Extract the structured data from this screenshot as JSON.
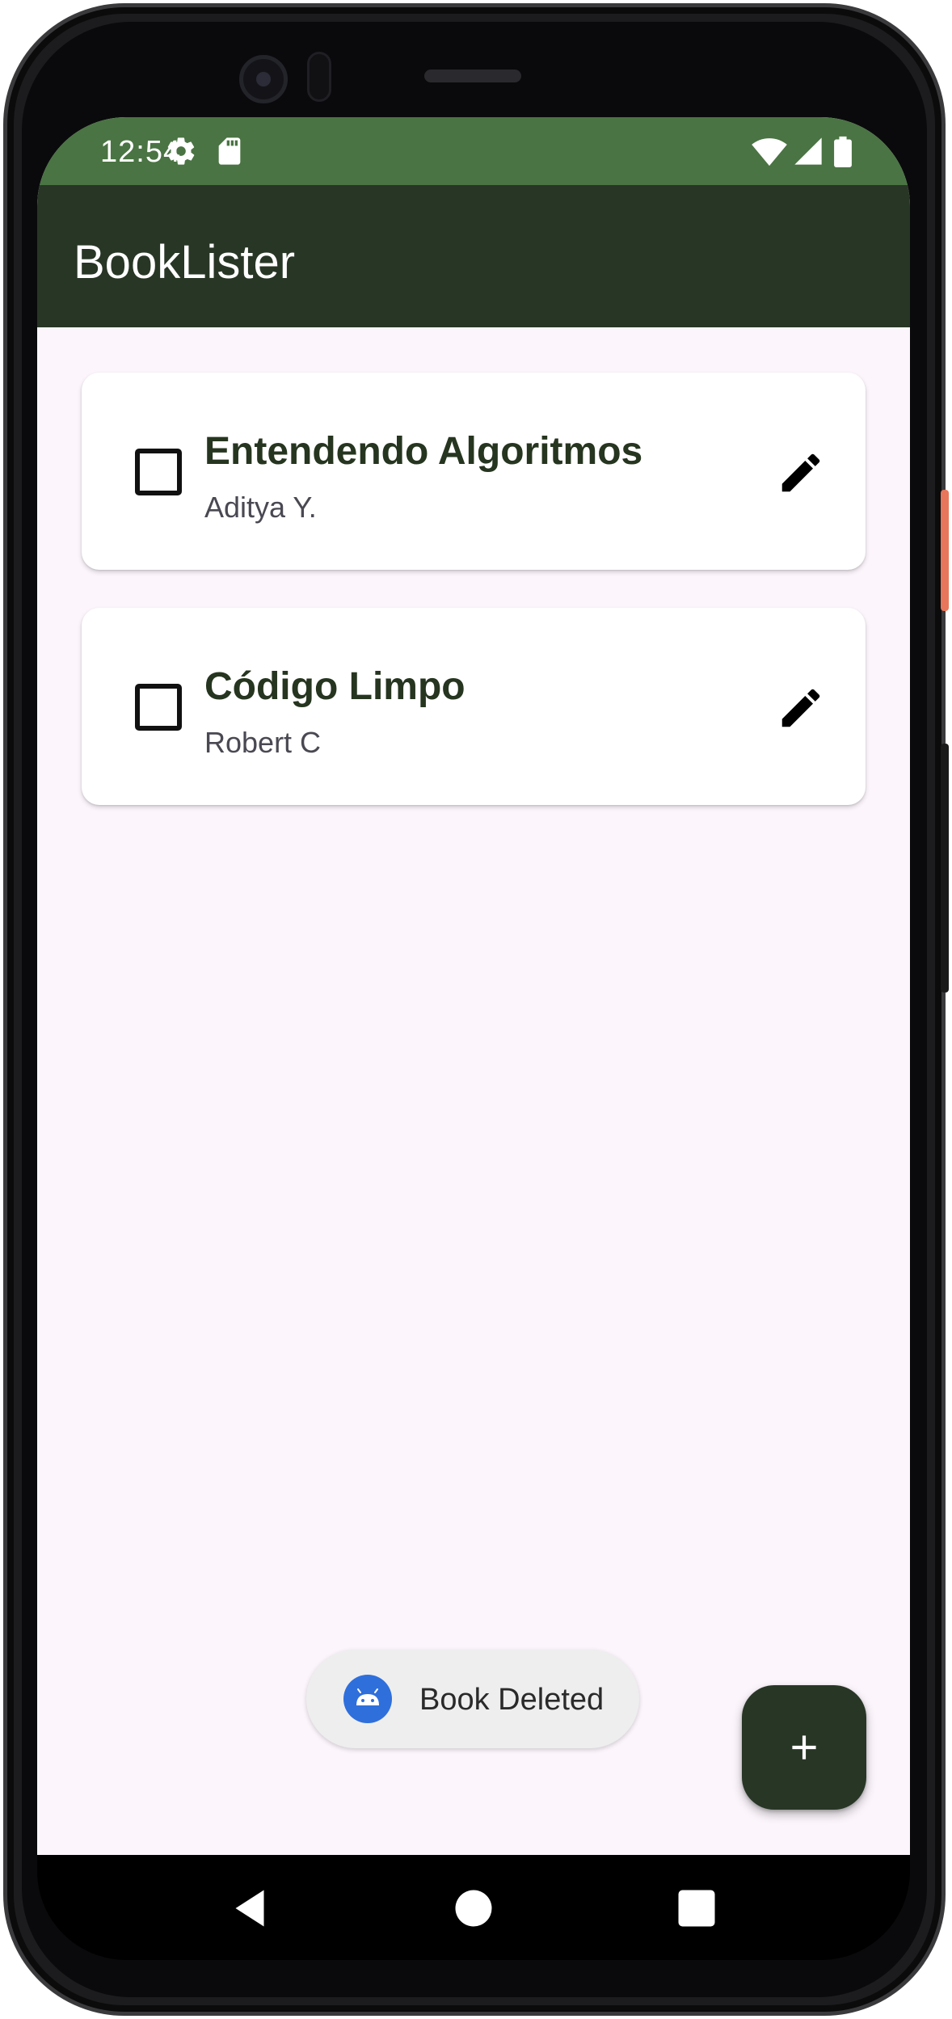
{
  "status_bar": {
    "time": "12:54",
    "icons": [
      "settings-gear-icon",
      "sd-card-icon",
      "wifi-icon",
      "cell-signal-icon",
      "battery-icon"
    ]
  },
  "app_bar": {
    "title": "BookLister"
  },
  "books": [
    {
      "title": "Entendendo Algoritmos",
      "author": "Aditya Y.",
      "checked": false
    },
    {
      "title": "Código Limpo",
      "author": "Robert C",
      "checked": false
    }
  ],
  "toast": {
    "message": "Book Deleted",
    "icon": "android-icon"
  },
  "fab": {
    "icon": "plus-icon"
  },
  "nav_bar": {
    "buttons": [
      "back-icon",
      "home-icon",
      "recents-icon"
    ]
  },
  "colors": {
    "status_bar": "#4a7443",
    "app_bar": "#283626",
    "background": "#fcf6fc",
    "title_text": "#26351f",
    "fab": "#283626",
    "toast_icon": "#2f6fdc"
  }
}
